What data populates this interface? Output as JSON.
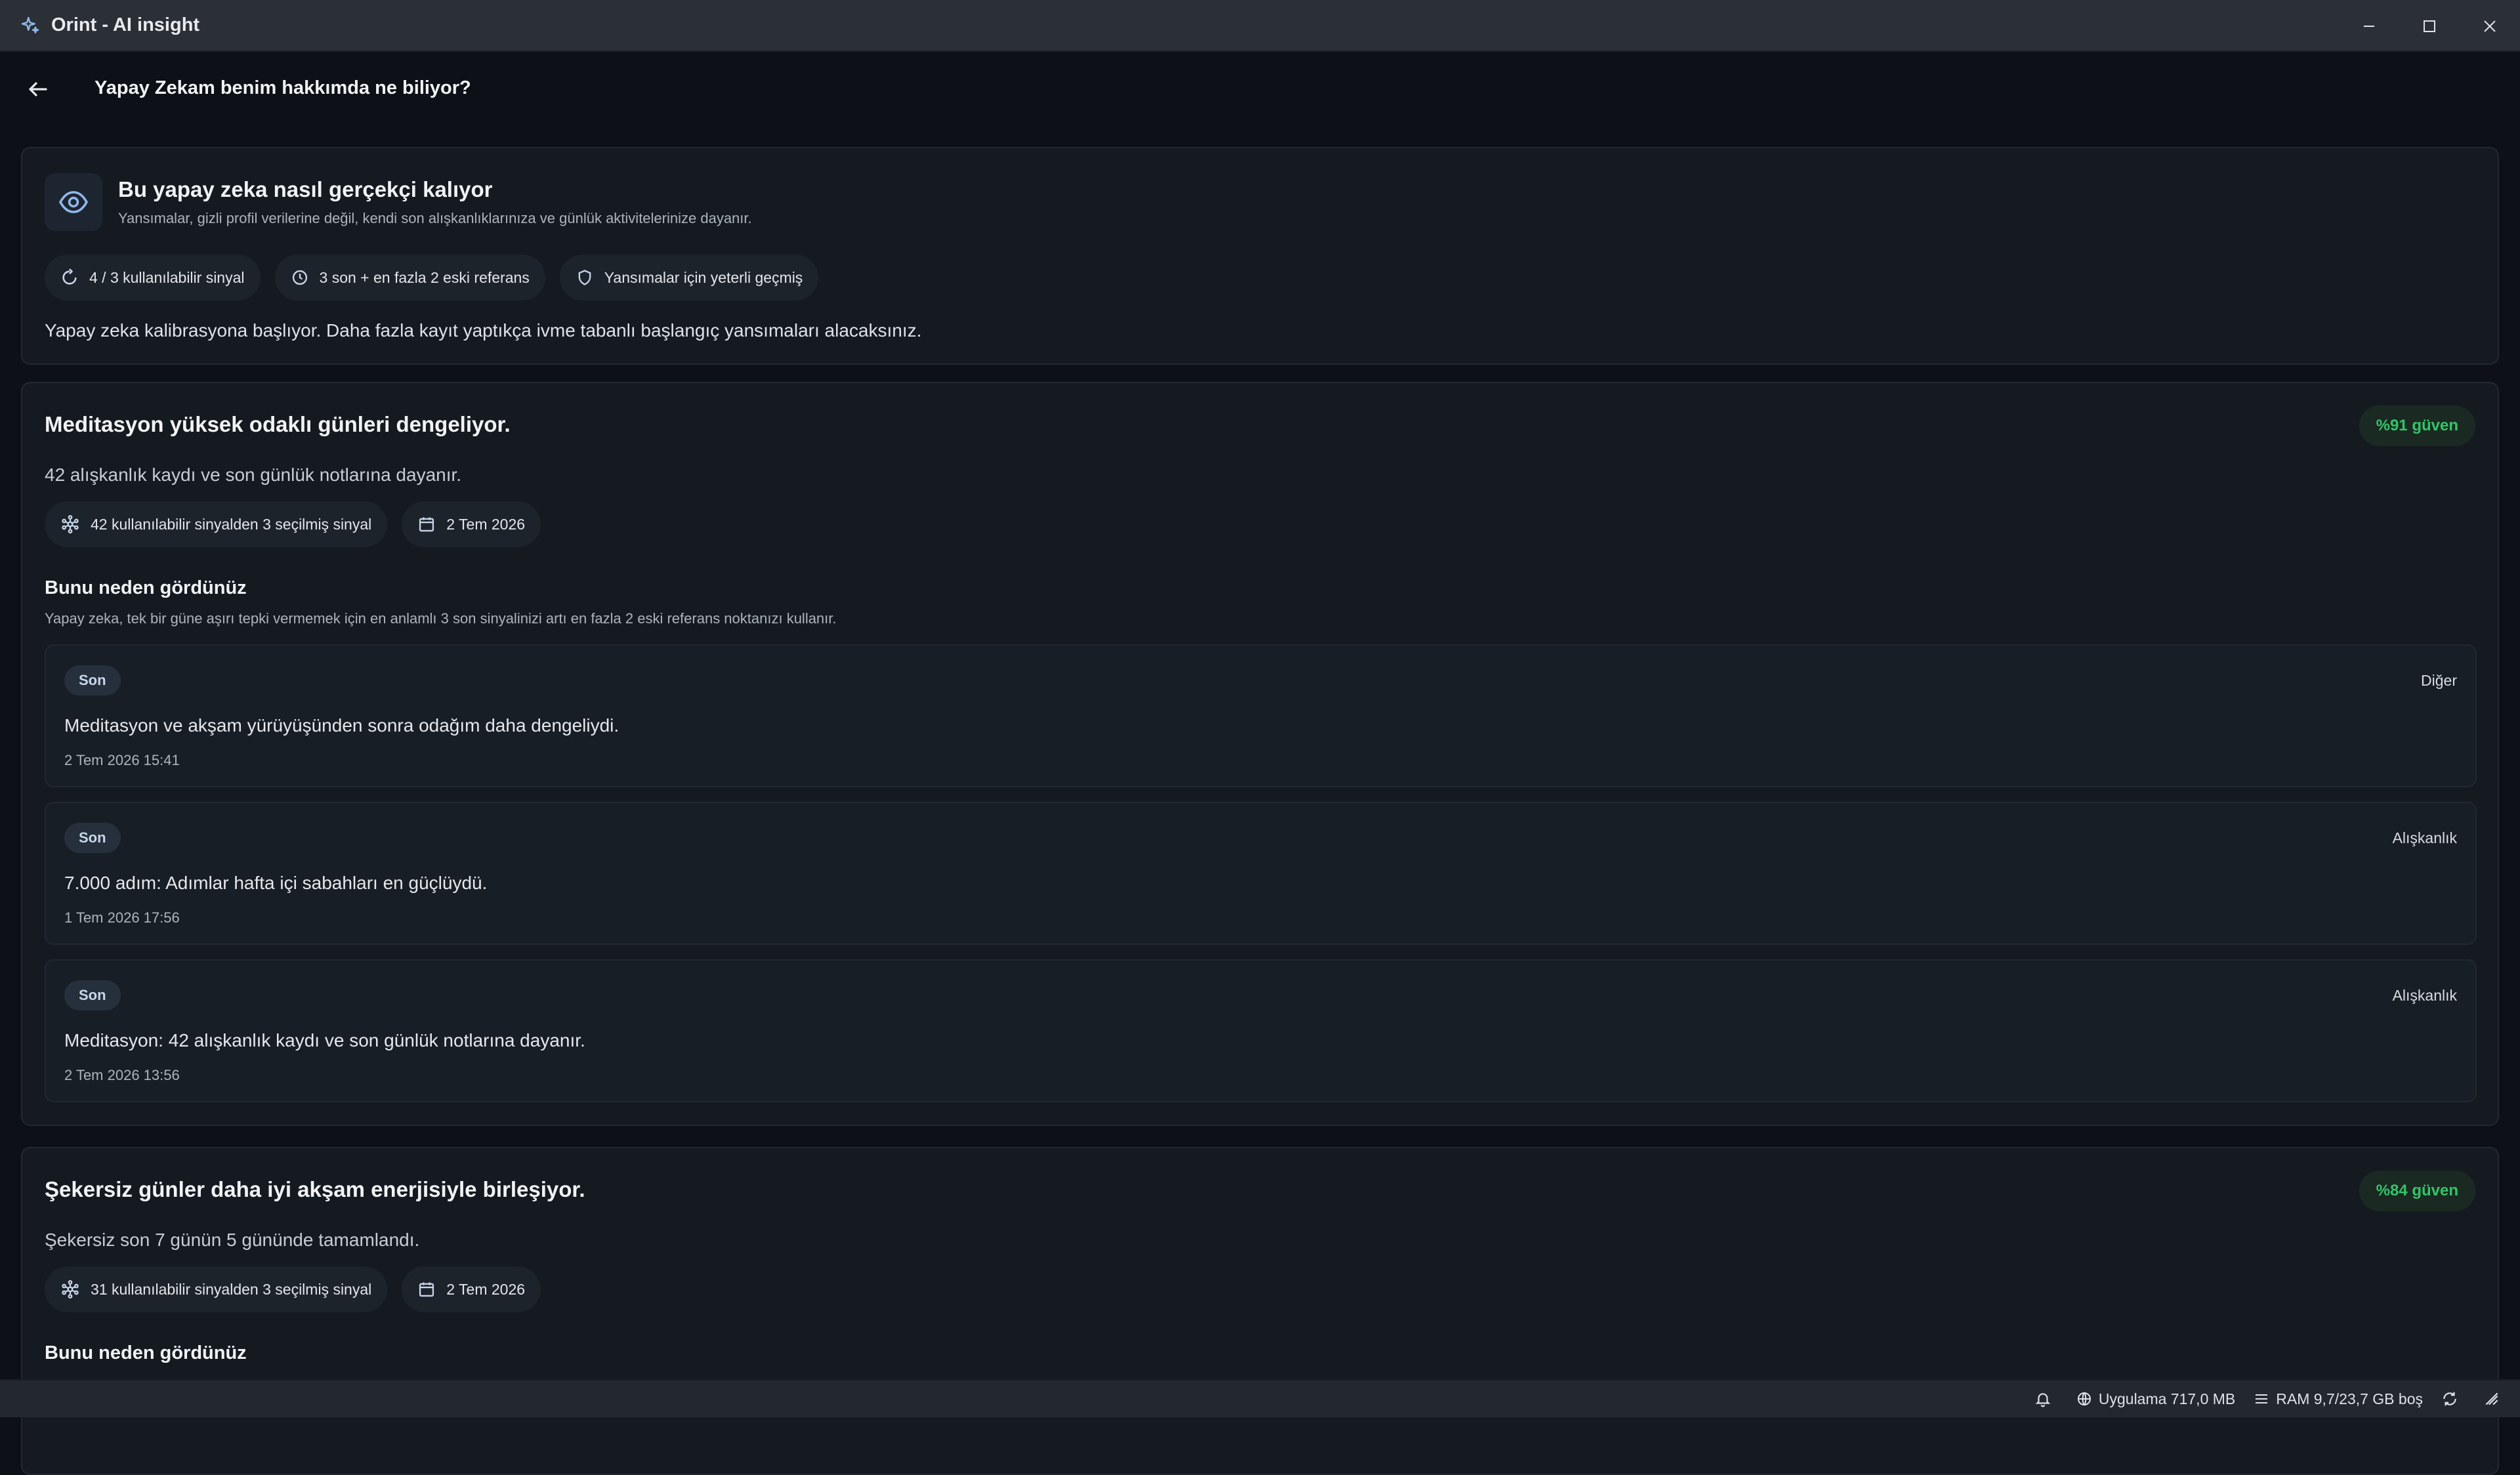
{
  "window": {
    "title": "Orint - AI insight"
  },
  "header": {
    "title": "Yapay Zekam benim hakkımda ne biliyor?"
  },
  "intro": {
    "title": "Bu yapay zeka nasıl gerçekçi kalıyor",
    "subtitle": "Yansımalar, gizli profil verilerine değil, kendi son alışkanlıklarınıza ve günlük aktivitelerinize dayanır.",
    "chips": [
      {
        "icon": "circle-refresh-icon",
        "label": "4 / 3 kullanılabilir sinyal"
      },
      {
        "icon": "history-icon",
        "label": "3 son + en fazla 2 eski referans"
      },
      {
        "icon": "shield-icon",
        "label": "Yansımalar için yeterli geçmiş"
      }
    ],
    "text": "Yapay zeka kalibrasyona başlıyor. Daha fazla kayıt yaptıkça ivme tabanlı başlangıç yansımaları alacaksınız."
  },
  "insights": [
    {
      "title": "Meditasyon yüksek odaklı günleri dengeliyor.",
      "confidence": "%91 güven",
      "description": "42 alışkanlık kaydı ve son günlük notlarına dayanır.",
      "chips": [
        {
          "icon": "hub-icon",
          "label": "42 kullanılabilir sinyalden 3 seçilmiş sinyal"
        },
        {
          "icon": "calendar-icon",
          "label": "2 Tem 2026"
        }
      ],
      "why_title": "Bunu neden gördünüz",
      "why_desc": "Yapay zeka, tek bir güne aşırı tepki vermemek için en anlamlı 3 son sinyalinizi artı en fazla 2 eski referans noktanızı kullanır.",
      "signals": [
        {
          "tag": "Son",
          "category": "Diğer",
          "text": "Meditasyon ve akşam yürüyüşünden sonra odağım daha dengeliydi.",
          "time": "2 Tem 2026 15:41"
        },
        {
          "tag": "Son",
          "category": "Alışkanlık",
          "text": "7.000 adım: Adımlar hafta içi sabahları en güçlüydü.",
          "time": "1 Tem 2026 17:56"
        },
        {
          "tag": "Son",
          "category": "Alışkanlık",
          "text": "Meditasyon: 42 alışkanlık kaydı ve son günlük notlarına dayanır.",
          "time": "2 Tem 2026 13:56"
        }
      ]
    },
    {
      "title": "Şekersiz günler daha iyi akşam enerjisiyle birleşiyor.",
      "confidence": "%84 güven",
      "description": "Şekersiz son 7 günün 5 gününde tamamlandı.",
      "chips": [
        {
          "icon": "hub-icon",
          "label": "31 kullanılabilir sinyalden 3 seçilmiş sinyal"
        },
        {
          "icon": "calendar-icon",
          "label": "2 Tem 2026"
        }
      ],
      "why_title": "Bunu neden gördünüz"
    }
  ],
  "statusbar": {
    "app_memory": "Uygulama 717,0 MB",
    "ram": "RAM 9,7/23,7 GB boş"
  },
  "colors": {
    "background": "#0d1117",
    "card": "#151a21",
    "confidence_green": "#34c469",
    "accent_blue": "#8fb8ea"
  }
}
